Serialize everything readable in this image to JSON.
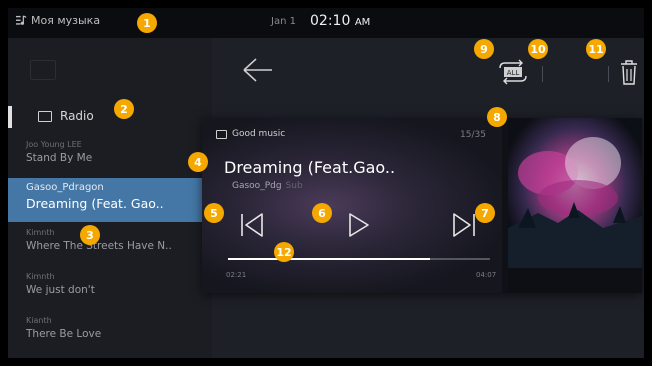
{
  "status_bar": {
    "app_title": "Моя музыка",
    "date": "Jan 1",
    "time": "02:10",
    "ampm": "AM"
  },
  "sidebar": {
    "radio_label": "Radio",
    "items": [
      {
        "artist": "Joo Young LEE",
        "song": "Stand By Me",
        "active": false
      },
      {
        "artist": "Gasoo_Pdragon",
        "song": "Dreaming (Feat. Gao..",
        "active": true
      },
      {
        "artist": "Kimnth",
        "song": "Where The Streets Have N..",
        "active": false
      },
      {
        "artist": "Kimnth",
        "song": "We just don't",
        "active": false
      },
      {
        "artist": "Kianth",
        "song": "There Be Love",
        "active": false
      }
    ]
  },
  "player": {
    "folder": "Good music",
    "track_count": "15/35",
    "title": "Dreaming (Feat.Gao..",
    "artist": "Gasoo_Pdg",
    "artist_sub": "Sub",
    "time_elapsed": "02:21",
    "time_total": "04:07",
    "progress": 0.77
  },
  "icons": {
    "back": "arrow-left-icon",
    "repeat": "repeat-all-icon",
    "delete": "trash-icon",
    "previous": "skip-previous-icon",
    "play": "play-icon",
    "next": "skip-next-icon"
  },
  "repeat_badge": "ALL",
  "markers": [
    "1",
    "2",
    "3",
    "4",
    "5",
    "6",
    "7",
    "8",
    "9",
    "10",
    "11",
    "12"
  ],
  "colors": {
    "accent_marker": "#f5a800",
    "selected_row": "#4477a6"
  }
}
